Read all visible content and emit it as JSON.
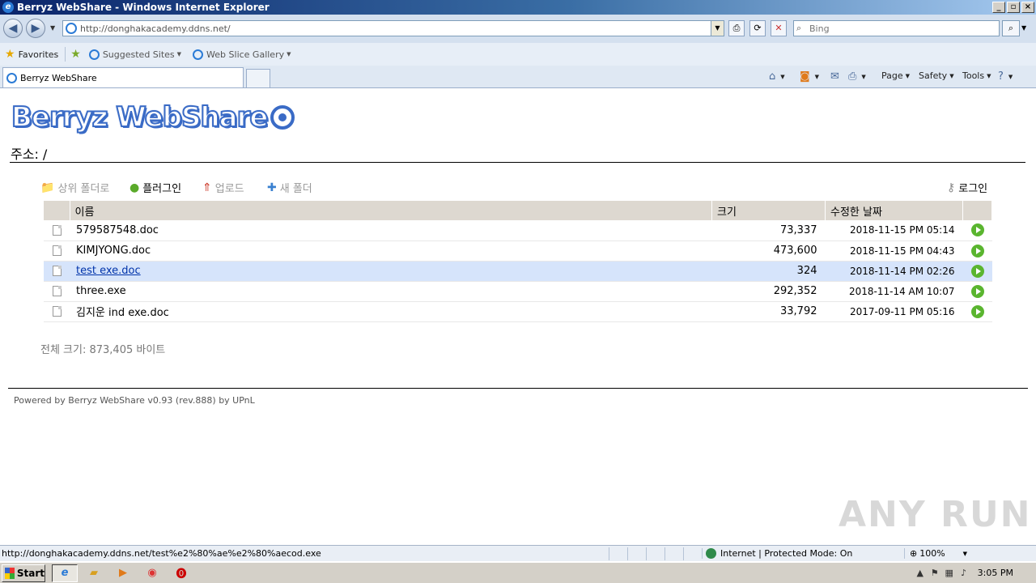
{
  "window": {
    "title": "Berryz WebShare - Windows Internet Explorer"
  },
  "browser": {
    "url": "http://donghakacademy.ddns.net/",
    "search_placeholder": "Bing",
    "favorites_label": "Favorites",
    "suggested_sites": "Suggested Sites",
    "web_slice_gallery": "Web Slice Gallery",
    "tab_title": "Berryz WebShare",
    "commands": {
      "page": "Page",
      "safety": "Safety",
      "tools": "Tools"
    }
  },
  "page": {
    "logo_text": "Berryz WebShare",
    "path_label": "주소: /",
    "toolbar": {
      "parent_folder": "상위 폴더로",
      "plugin": "플러그인",
      "upload": "업로드",
      "new_folder": "새 폴더",
      "login": "로그인"
    },
    "columns": {
      "name": "이름",
      "size": "크기",
      "modified": "수정한 날짜"
    },
    "files": [
      {
        "name": "579587548.doc",
        "size": "73,337",
        "date": "2018-11-15 PM 05:14"
      },
      {
        "name": "KIMJYONG.doc",
        "size": "473,600",
        "date": "2018-11-15 PM 04:43"
      },
      {
        "name": "test exe.doc",
        "size": "324",
        "date": "2018-11-14 PM 02:26"
      },
      {
        "name": "three.exe",
        "size": "292,352",
        "date": "2018-11-14 AM 10:07"
      },
      {
        "name": "김지운 ind exe.doc",
        "size": "33,792",
        "date": "2017-09-11 PM 05:16"
      }
    ],
    "total": "전체 크기: 873,405 바이트",
    "footer": "Powered by Berryz WebShare v0.93 (rev.888) by UPnL"
  },
  "statusbar": {
    "url": "http://donghakacademy.ddns.net/test%e2%80%ae%e2%80%aecod.exe",
    "zone": "Internet | Protected Mode: On",
    "zoom": "100%"
  },
  "taskbar": {
    "start": "Start",
    "clock": "3:05 PM"
  },
  "watermark": "ANY RUN",
  "colors": {
    "accent": "#3a6bc6",
    "selected_row": "#d6e4fb",
    "header_bg": "#ddd8d0"
  }
}
